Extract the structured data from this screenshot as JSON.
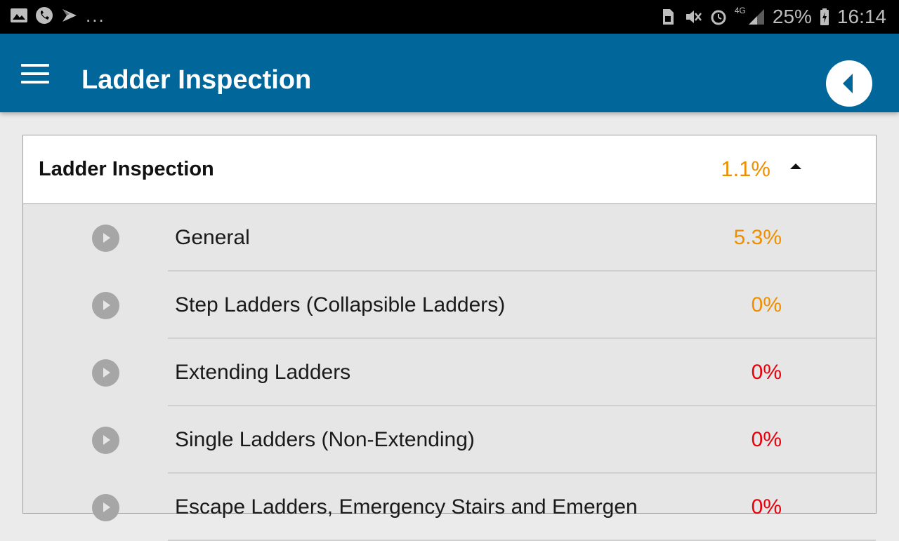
{
  "status_bar": {
    "overflow_dots": "...",
    "battery": "25%",
    "time": "16:14",
    "network": "4G",
    "left_icons": [
      "gallery-icon",
      "phone-icon",
      "play-store-icon"
    ],
    "right_icons": [
      "sim-icon",
      "mute-icon",
      "alarm-icon",
      "signal-icon",
      "battery-charging-icon"
    ]
  },
  "app_bar": {
    "title": "Ladder Inspection",
    "menu_icon": "hamburger-menu-icon",
    "back_icon": "back-arrow-icon",
    "background": "#01679b"
  },
  "section": {
    "title": "Ladder Inspection",
    "percent": "1.1%",
    "percent_color": "#ef8f00",
    "expanded": true,
    "items": [
      {
        "label": "General",
        "percent": "5.3%",
        "color": "#ef8f00"
      },
      {
        "label": "Step Ladders (Collapsible Ladders)",
        "percent": "0%",
        "color": "#ef8f00"
      },
      {
        "label": "Extending Ladders",
        "percent": "0%",
        "color": "#e8000b"
      },
      {
        "label": "Single Ladders (Non-Extending)",
        "percent": "0%",
        "color": "#e8000b"
      },
      {
        "label": "Escape Ladders, Emergency Stairs and Emergen",
        "percent": "0%",
        "color": "#e8000b"
      }
    ]
  }
}
